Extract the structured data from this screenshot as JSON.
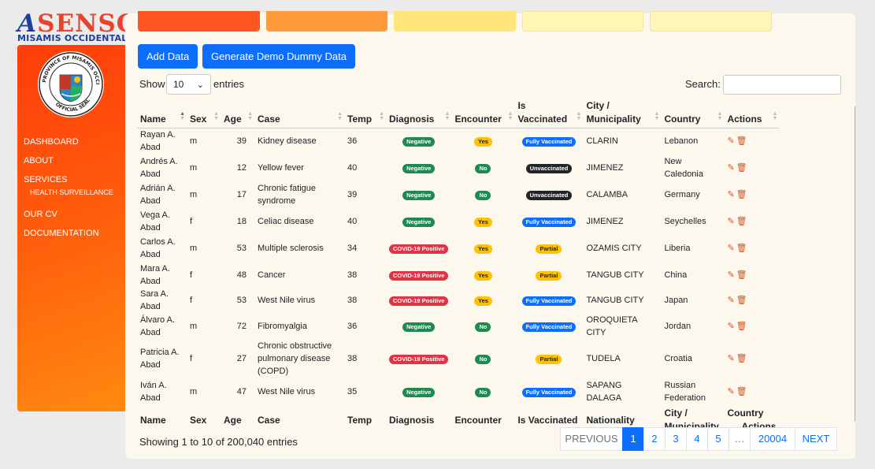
{
  "brand": {
    "logo_main": "ASENSO",
    "logo_sub": "MISAMIS OCCIDENTAL",
    "seal_top": "PROVINCE OF MISAMIS OCCIDENTAL",
    "seal_bottom": "OFFICIAL SEAL"
  },
  "colors": {
    "accent": "#ff5a0c",
    "primary": "#0d6efd",
    "card1": "#ff5622",
    "card2": "#ff9a3c",
    "card3": "#ffe57a",
    "card4": "#fff6b3",
    "card5": "#fff6b8"
  },
  "nav": {
    "items": [
      {
        "label": "DASHBOARD"
      },
      {
        "label": "ABOUT"
      },
      {
        "label": "SERVICES"
      },
      {
        "label": "OUR CV"
      },
      {
        "label": "DOCUMENTATION"
      }
    ],
    "sub_health": "HEALTH SURVEILLANCE"
  },
  "toolbar": {
    "add_label": "Add Data",
    "generate_label": "Generate Demo Dummy Data"
  },
  "table_controls": {
    "show_label": "Show",
    "show_value": "10",
    "entries_label": "entries",
    "search_label": "Search:",
    "search_value": ""
  },
  "table": {
    "headers": [
      "Name",
      "Sex",
      "Age",
      "Case",
      "Temp",
      "Diagnosis",
      "Encounter",
      "Is Vaccinated",
      "City / Municipality",
      "Country",
      "Actions"
    ],
    "footer_headers": [
      "Name",
      "Sex",
      "Age",
      "Case",
      "Temp",
      "Diagnosis",
      "Encounter",
      "Is Vaccinated",
      "Nationality",
      "City / Municipality",
      "Country",
      "Actions"
    ],
    "rows": [
      {
        "name": "Rayan A. Abad",
        "sex": "m",
        "age": "39",
        "case": "Kidney disease",
        "temp": "36",
        "diagnosis": "Negative",
        "encounter": "Yes",
        "vaccinated": "Fully Vaccinated",
        "city": "CLARIN",
        "country": "Lebanon"
      },
      {
        "name": "Andrés A. Abad",
        "sex": "m",
        "age": "12",
        "case": "Yellow fever",
        "temp": "40",
        "diagnosis": "Negative",
        "encounter": "No",
        "vaccinated": "Unvaccinated",
        "city": "JIMENEZ",
        "country": "New Caledonia"
      },
      {
        "name": "Adrián A. Abad",
        "sex": "m",
        "age": "17",
        "case": "Chronic fatigue syndrome",
        "temp": "39",
        "diagnosis": "Negative",
        "encounter": "No",
        "vaccinated": "Unvaccinated",
        "city": "CALAMBA",
        "country": "Germany"
      },
      {
        "name": "Vega A. Abad",
        "sex": "f",
        "age": "18",
        "case": "Celiac disease",
        "temp": "40",
        "diagnosis": "Negative",
        "encounter": "Yes",
        "vaccinated": "Fully Vaccinated",
        "city": "JIMENEZ",
        "country": "Seychelles"
      },
      {
        "name": "Carlos A. Abad",
        "sex": "m",
        "age": "53",
        "case": "Multiple sclerosis",
        "temp": "34",
        "diagnosis": "COVID-19 Positive",
        "encounter": "Yes",
        "vaccinated": "Partial",
        "city": "OZAMIS CITY",
        "country": "Liberia"
      },
      {
        "name": "Mara A. Abad",
        "sex": "f",
        "age": "48",
        "case": "Cancer",
        "temp": "38",
        "diagnosis": "COVID-19 Positive",
        "encounter": "Yes",
        "vaccinated": "Partial",
        "city": "TANGUB CITY",
        "country": "China"
      },
      {
        "name": "Sara A. Abad",
        "sex": "f",
        "age": "53",
        "case": "West Nile virus",
        "temp": "38",
        "diagnosis": "COVID-19 Positive",
        "encounter": "Yes",
        "vaccinated": "Fully Vaccinated",
        "city": "TANGUB CITY",
        "country": "Japan"
      },
      {
        "name": "Álvaro A. Abad",
        "sex": "m",
        "age": "72",
        "case": "Fibromyalgia",
        "temp": "36",
        "diagnosis": "Negative",
        "encounter": "No",
        "vaccinated": "Fully Vaccinated",
        "city": "OROQUIETA CITY",
        "country": "Jordan"
      },
      {
        "name": "Patricia A. Abad",
        "sex": "f",
        "age": "27",
        "case": "Chronic obstructive pulmonary disease (COPD)",
        "temp": "38",
        "diagnosis": "COVID-19 Positive",
        "encounter": "No",
        "vaccinated": "Partial",
        "city": "TUDELA",
        "country": "Croatia"
      },
      {
        "name": "Iván A. Abad",
        "sex": "m",
        "age": "47",
        "case": "West Nile virus",
        "temp": "35",
        "diagnosis": "Negative",
        "encounter": "No",
        "vaccinated": "Fully Vaccinated",
        "city": "SAPANG DALAGA",
        "country": "Russian Federation"
      }
    ]
  },
  "pagination": {
    "info": "Showing 1 to 10 of 200,040 entries",
    "pages": [
      "PREVIOUS",
      "1",
      "2",
      "3",
      "4",
      "5",
      "…",
      "20004",
      "NEXT"
    ],
    "active": "1"
  }
}
